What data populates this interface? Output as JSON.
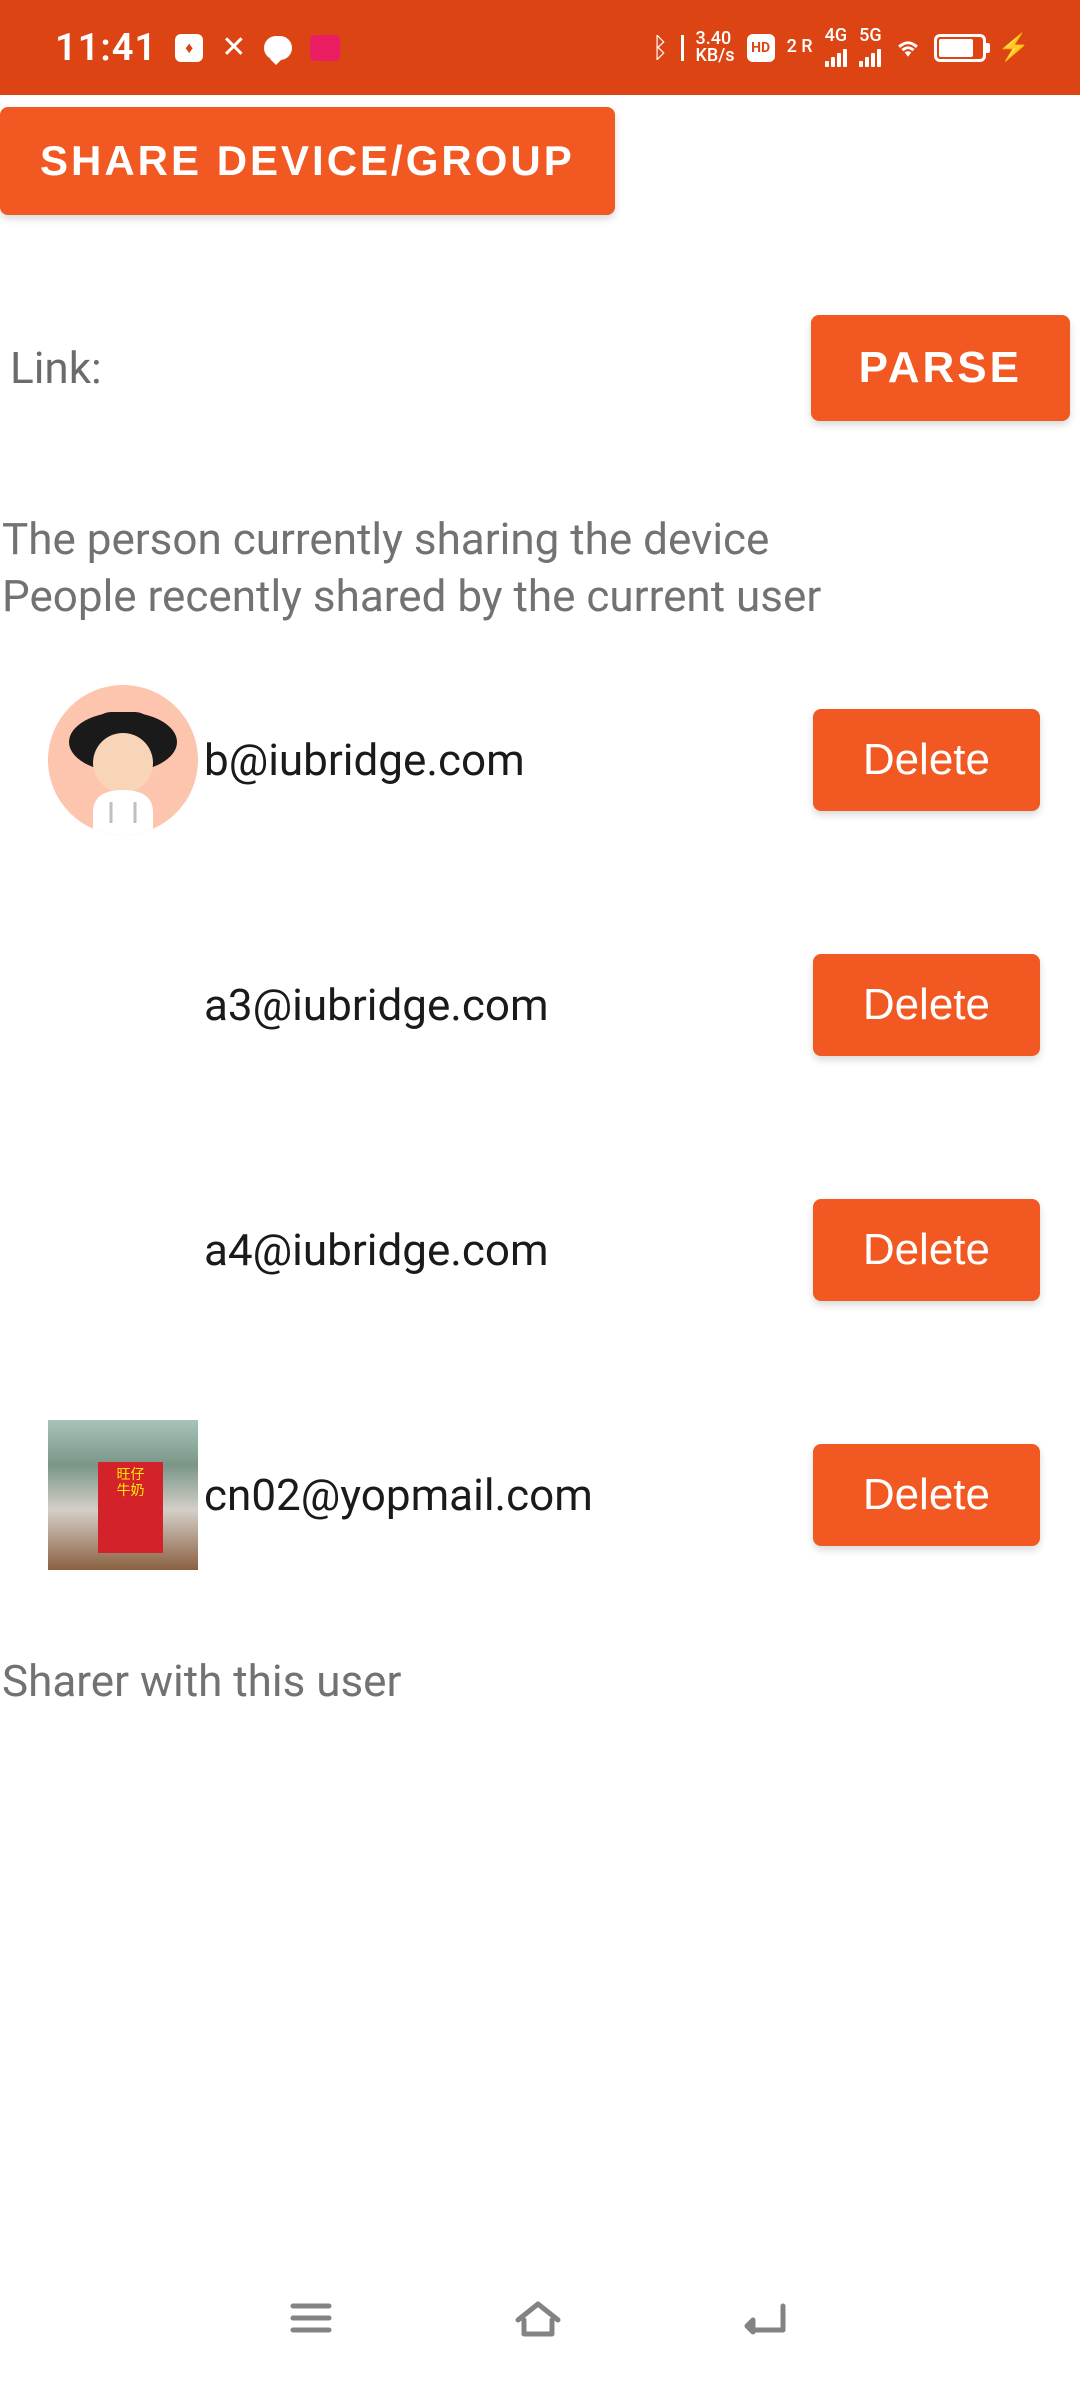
{
  "status_bar": {
    "time": "11:41",
    "kb_rate": "3.40",
    "kb_unit": "KB/s",
    "hd_label": "HD",
    "net_sub": "2 R",
    "net_4g": "4G",
    "net_5g": "5G"
  },
  "buttons": {
    "share_device": "SHARE DEVICE/GROUP",
    "parse": "PARSE",
    "delete": "Delete"
  },
  "labels": {
    "link": "Link:",
    "sharing_header_line1": "The person currently sharing the device",
    "sharing_header_line2": "People recently shared by the current user",
    "sharer_footer": "Sharer with this user"
  },
  "users": [
    {
      "email": "b@iubridge.com",
      "avatar_type": "illustration"
    },
    {
      "email": "a3@iubridge.com",
      "avatar_type": "none"
    },
    {
      "email": "a4@iubridge.com",
      "avatar_type": "none"
    },
    {
      "email": "cn02@yopmail.com",
      "avatar_type": "photo"
    }
  ],
  "colors": {
    "accent": "#f25821",
    "status_bg": "#dc4513"
  }
}
